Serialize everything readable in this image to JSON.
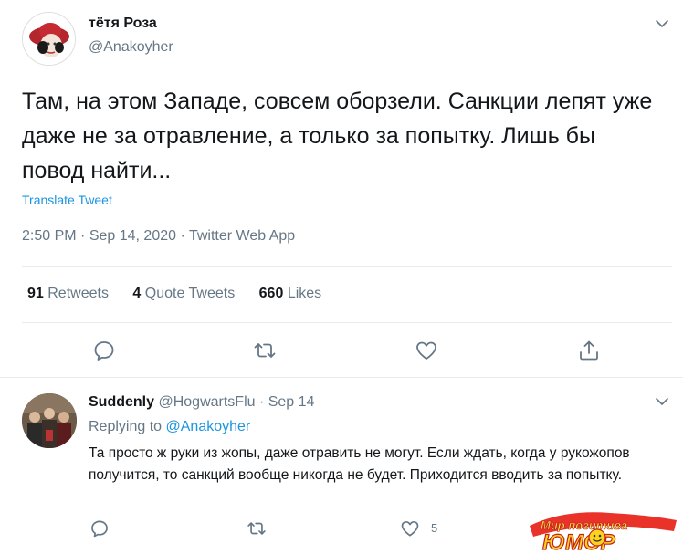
{
  "tweet": {
    "display_name": "тётя Роза",
    "handle": "@Anakoyher",
    "text": "Там, на этом Западе, совсем оборзели. Санкции лепят уже даже не за отравление, а только за попытку. Лишь бы повод найти...",
    "translate_label": "Translate Tweet",
    "time": "2:50 PM",
    "sep1": " · ",
    "date": "Sep 14, 2020",
    "sep2": " · ",
    "source": "Twitter Web App",
    "stats": {
      "retweets_count": "91",
      "retweets_label": "Retweets",
      "quotes_count": "4",
      "quotes_label": "Quote Tweets",
      "likes_count": "660",
      "likes_label": "Likes"
    },
    "icons": [
      "reply-icon",
      "retweet-icon",
      "like-icon",
      "share-icon",
      "chevron-down-icon"
    ]
  },
  "reply": {
    "display_name": "Suddenly",
    "handle": "@HogwartsFlu",
    "sep": " · ",
    "date": "Sep 14",
    "replying_prefix": "Replying to ",
    "replying_to": "@Anakoyher",
    "text": "Та просто ж руки из жопы, даже отравить не могут. Если ждать, когда у рукожопов получится, то санкций вообще никогда не будет. Приходится вводить за попытку.",
    "like_count": "5"
  },
  "watermark": {
    "line1": "Мир позитива",
    "line2": "ЮМОР"
  },
  "colors": {
    "text": "#14171a",
    "secondary": "#657786",
    "link": "#1b95e0",
    "divider": "#e6ecf0"
  }
}
